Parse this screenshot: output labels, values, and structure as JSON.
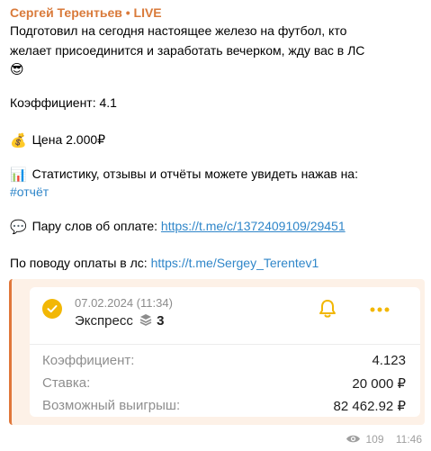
{
  "message": {
    "author": "Сергей Терентьев • LIVE",
    "intro_line1": "Подготовил на сегодня настоящее железо на футбол, кто",
    "intro_line2": "желает присоединится и заработать вечерком, жду вас в ЛС",
    "intro_emoji": "😎",
    "coefficient_text": "Коэффициент: 4.1",
    "price_emoji": "💰",
    "price_text": "Цена 2.000₽",
    "stats_emoji": "📊",
    "stats_text": "Статистику, отзывы и отчёты можете увидеть нажав на:",
    "hashtag": "#отчёт",
    "payment_emoji": "💬",
    "payment_text": "Пару слов об оплате: ",
    "payment_link": "https://t.me/c/1372409109/29451",
    "contact_text": "По поводу оплаты в лс: ",
    "contact_link": "https://t.me/Sergey_Terentev1"
  },
  "bet_card": {
    "date": "07.02.2024 (11:34)",
    "type": "Экспресс",
    "events_count": "3",
    "rows": [
      {
        "label": "Коэффициент:",
        "value": "4.123"
      },
      {
        "label": "Ставка:",
        "value": "20 000 ₽"
      },
      {
        "label": "Возможный выигрыш:",
        "value": "82 462.92 ₽"
      }
    ],
    "accent_color": "#f2b705",
    "icons": [
      "check-circle-icon",
      "stack-icon",
      "bell-icon",
      "more-dots-icon"
    ]
  },
  "footer": {
    "views": "109",
    "time": "11:46",
    "icon": "eye-icon"
  },
  "colors": {
    "author": "#d97a3a",
    "link": "#2f86c9",
    "quote_bg": "#fdf1e7",
    "quote_border": "#e0773a"
  }
}
